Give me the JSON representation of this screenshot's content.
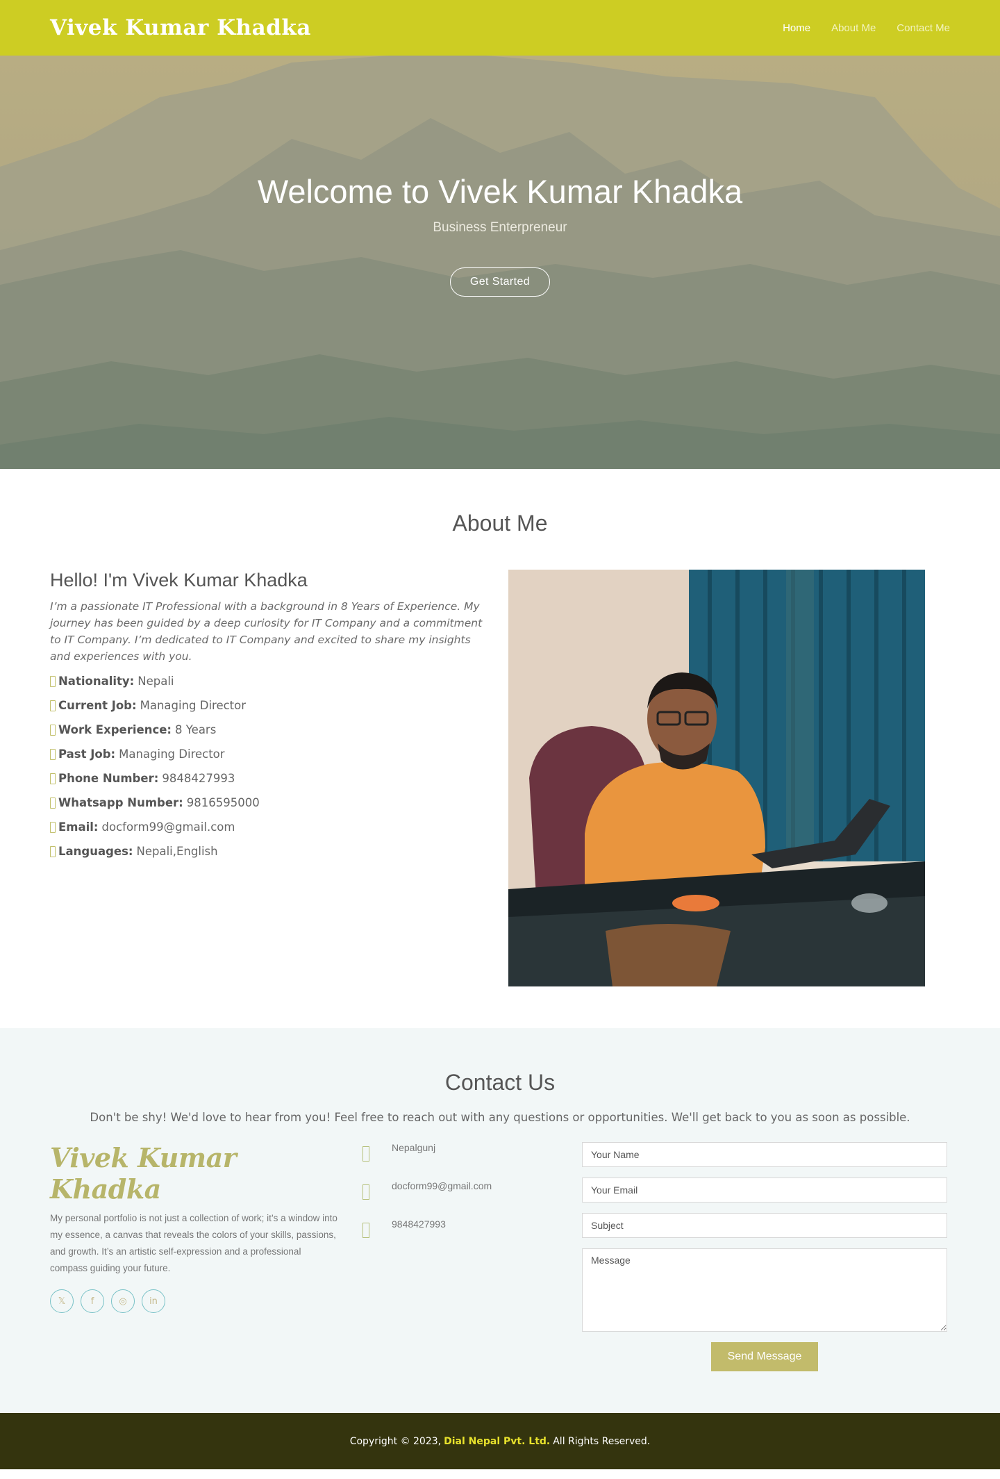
{
  "header": {
    "brand": "Vivek Kumar Khadka",
    "nav": [
      {
        "label": "Home",
        "active": true
      },
      {
        "label": "About Me",
        "active": false
      },
      {
        "label": "Contact Me",
        "active": false
      }
    ]
  },
  "hero": {
    "title": "Welcome to Vivek Kumar Khadka",
    "subtitle": "Business Enterpreneur",
    "button": "Get Started"
  },
  "about": {
    "section_title": "About Me",
    "heading": "Hello! I'm Vivek Kumar Khadka",
    "intro": "I’m a passionate IT Professional with a background in 8 Years of Experience. My journey has been guided by a deep curiosity for IT Company and a commitment to IT Company. I’m dedicated to IT Company and excited to share my insights and experiences with you.",
    "facts": [
      {
        "label": "Nationality:",
        "value": "Nepali"
      },
      {
        "label": "Current Job:",
        "value": "Managing Director"
      },
      {
        "label": "Work Experience:",
        "value": "8 Years"
      },
      {
        "label": "Past Job:",
        "value": "Managing Director"
      },
      {
        "label": "Phone Number:",
        "value": "9848427993"
      },
      {
        "label": "Whatsapp Number:",
        "value": "9816595000"
      },
      {
        "label": "Email:",
        "value": "docform99@gmail.com"
      },
      {
        "label": "Languages:",
        "value": "Nepali,English"
      }
    ]
  },
  "contact": {
    "section_title": "Contact Us",
    "description": "Don't be shy! We'd love to hear from you! Feel free to reach out with any questions or opportunities. We'll get back to you as soon as possible.",
    "brand_title": "Vivek Kumar Khadka",
    "brand_text": "My personal portfolio is not just a collection of work; it’s a window into my essence, a canvas that reveals the colors of your skills, passions, and growth. It’s an artistic self-expression and a professional compass guiding your future.",
    "socials": [
      "twitter-icon",
      "facebook-icon",
      "instagram-icon",
      "linkedin-icon"
    ],
    "info": {
      "location": "Nepalgunj",
      "email": "docform99@gmail.com",
      "phone": "9848427993"
    },
    "form": {
      "name_placeholder": "Your Name",
      "email_placeholder": "Your Email",
      "subject_placeholder": "Subject",
      "message_placeholder": "Message",
      "send_label": "Send Message"
    }
  },
  "footer": {
    "prefix": "Copyright © 2023,",
    "company": "Dial Nepal Pvt. Ltd.",
    "suffix": "All Rights Reserved."
  },
  "colors": {
    "header_bg": "#cdcd23",
    "accent": "#c2bb6b",
    "footer_bg": "#34340e",
    "footer_company": "#e8e22c"
  }
}
